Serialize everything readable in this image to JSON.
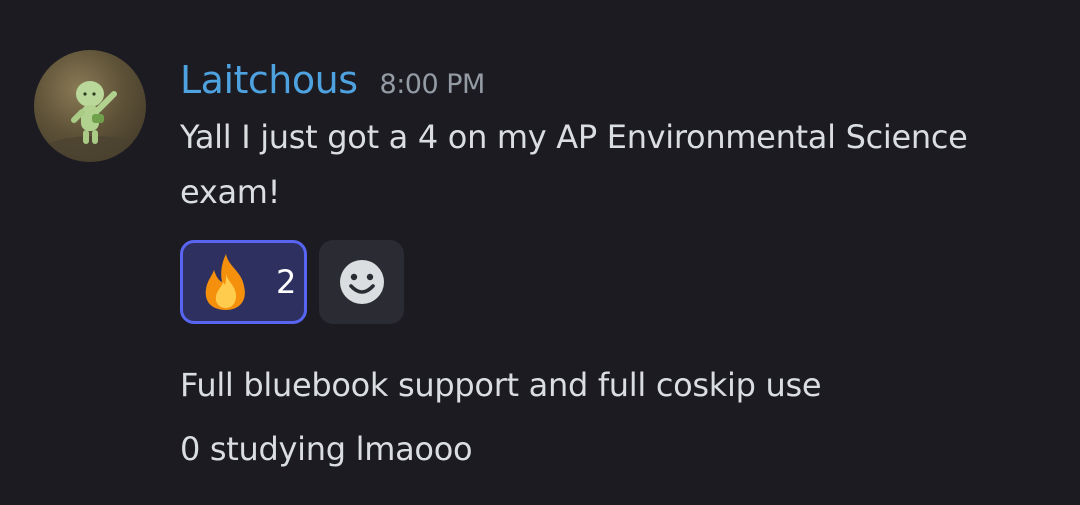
{
  "message": {
    "username": "Laitchous",
    "timestamp": "8:00 PM",
    "text_lines": [
      "Yall I just got a 4 on my AP Environmental Science",
      "exam!"
    ],
    "reactions": [
      {
        "emoji": "fire-emoji",
        "count": "2",
        "selected": true
      }
    ],
    "add_reaction_icon": "smiley-add-reaction-icon",
    "followups": [
      "Full bluebook support and full coskip use",
      "0 studying lmaooo"
    ]
  },
  "colors": {
    "background": "#1b1b21",
    "username": "#4ea2e0",
    "timestamp": "#949ba4",
    "text": "#dbdee1",
    "reaction_border": "#5865f2",
    "reaction_bg": "#2e3160",
    "add_reaction_bg": "#2b2c33"
  }
}
